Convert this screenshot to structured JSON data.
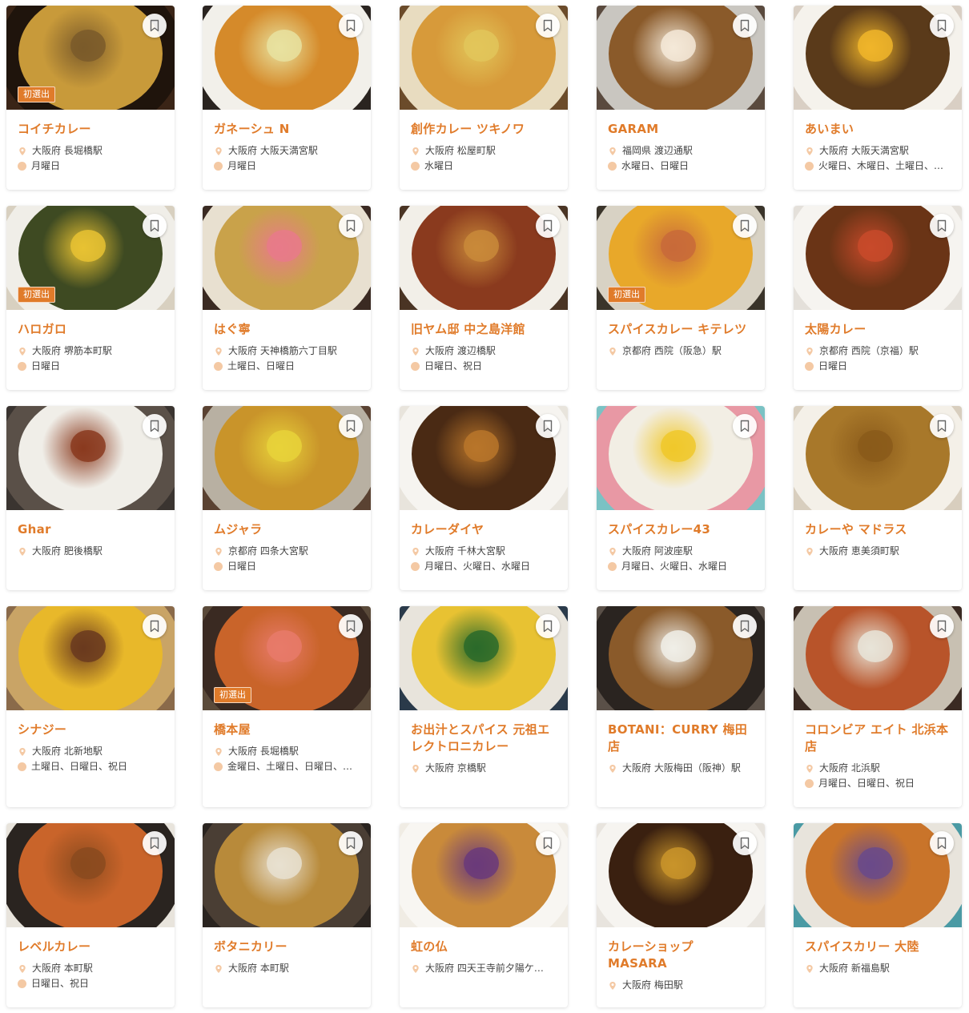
{
  "badge_label": "初選出",
  "accent_color": "#e07b2a",
  "icons": {
    "bookmark": "bookmark-icon",
    "location": "location-pin-icon",
    "holiday": "holiday-icon"
  },
  "rows": [
    [
      {
        "name": "コイチカレー",
        "location": "大阪府 長堀橋駅",
        "holiday": "月曜日",
        "badge": true,
        "photo": {
          "bg": "#3a2416",
          "plate": "#1f140c",
          "food": "#c89a3a",
          "accent": "#7a5a2a"
        }
      },
      {
        "name": "ガネーシュ N",
        "location": "大阪府 大阪天満宮駅",
        "holiday": "月曜日",
        "badge": false,
        "photo": {
          "bg": "#2a2420",
          "plate": "#f2f0ea",
          "food": "#d58a2a",
          "accent": "#e8e2a0"
        }
      },
      {
        "name": "創作カレー ツキノワ",
        "location": "大阪府 松屋町駅",
        "holiday": "水曜日",
        "badge": false,
        "photo": {
          "bg": "#6b4b2a",
          "plate": "#e8dcc0",
          "food": "#d79a3a",
          "accent": "#e2c65a"
        }
      },
      {
        "name": "GARAM",
        "location": "福岡県 渡辺通駅",
        "holiday": "水曜日、日曜日",
        "badge": false,
        "photo": {
          "bg": "#5a4a3e",
          "plate": "#c9c6c0",
          "food": "#8a5a2a",
          "accent": "#f4e9d8"
        }
      },
      {
        "name": "あいまい",
        "location": "大阪府 大阪天満宮駅",
        "holiday": "火曜日、木曜日、土曜日、…",
        "badge": false,
        "photo": {
          "bg": "#d9cfc4",
          "plate": "#f5f2ec",
          "food": "#5a3a1a",
          "accent": "#f0b52a"
        }
      }
    ],
    [
      {
        "name": "ハロガロ",
        "location": "大阪府 堺筋本町駅",
        "holiday": "日曜日",
        "badge": true,
        "photo": {
          "bg": "#d8d0c0",
          "plate": "#f0eee8",
          "food": "#3e4a22",
          "accent": "#e8c232"
        }
      },
      {
        "name": "はぐ寧",
        "location": "大阪府 天神橋筋六丁目駅",
        "holiday": "土曜日、日曜日",
        "badge": false,
        "photo": {
          "bg": "#3a2a22",
          "plate": "#e8e0d0",
          "food": "#c9a24a",
          "accent": "#e87a8a"
        }
      },
      {
        "name": "旧ヤム邸 中之島洋館",
        "location": "大阪府 渡辺橋駅",
        "holiday": "日曜日、祝日",
        "badge": false,
        "photo": {
          "bg": "#4a3424",
          "plate": "#f2efe8",
          "food": "#8a3a1e",
          "accent": "#c98a3a"
        }
      },
      {
        "name": "スパイスカレー キテレツ",
        "location": "京都府 西院（阪急）駅",
        "holiday": "",
        "badge": true,
        "photo": {
          "bg": "#3a342a",
          "plate": "#d8d2c4",
          "food": "#e8a82a",
          "accent": "#c86a3a"
        }
      },
      {
        "name": "太陽カレー",
        "location": "京都府 西院（京福）駅",
        "holiday": "日曜日",
        "badge": false,
        "photo": {
          "bg": "#e4e0da",
          "plate": "#f6f4f0",
          "food": "#6a3416",
          "accent": "#c84a2a"
        }
      }
    ],
    [
      {
        "name": "Ghar",
        "location": "大阪府 肥後橋駅",
        "holiday": "",
        "badge": false,
        "photo": {
          "bg": "#3a3430",
          "plate": "#5a5048",
          "food": "#f0eee8",
          "accent": "#8a3a1e"
        }
      },
      {
        "name": "ムジャラ",
        "location": "京都府 四条大宮駅",
        "holiday": "日曜日",
        "badge": false,
        "photo": {
          "bg": "#5a4232",
          "plate": "#b8b0a2",
          "food": "#c9942a",
          "accent": "#e8d23a"
        }
      },
      {
        "name": "カレーダイヤ",
        "location": "大阪府 千林大宮駅",
        "holiday": "月曜日、火曜日、水曜日",
        "badge": false,
        "photo": {
          "bg": "#e8e4dc",
          "plate": "#f6f4f0",
          "food": "#4a2a14",
          "accent": "#b8752a"
        }
      },
      {
        "name": "スパイスカレー43",
        "location": "大阪府 阿波座駅",
        "holiday": "月曜日、火曜日、水曜日",
        "badge": false,
        "photo": {
          "bg": "#7ac2c4",
          "plate": "#e898a4",
          "food": "#f2eee4",
          "accent": "#f0c82a"
        }
      },
      {
        "name": "カレーや マドラス",
        "location": "大阪府 恵美須町駅",
        "holiday": "",
        "badge": false,
        "photo": {
          "bg": "#d8cebe",
          "plate": "#f4f0e8",
          "food": "#a8782a",
          "accent": "#8a5a1a"
        }
      }
    ],
    [
      {
        "name": "シナジー",
        "location": "大阪府 北新地駅",
        "holiday": "土曜日、日曜日、祝日",
        "badge": false,
        "photo": {
          "bg": "#8a6a4a",
          "plate": "#c9a466",
          "food": "#e8b82a",
          "accent": "#6a3a1e"
        }
      },
      {
        "name": "橋本屋",
        "location": "大阪府 長堀橋駅",
        "holiday": "金曜日、土曜日、日曜日、…",
        "badge": true,
        "photo": {
          "bg": "#5a4a3a",
          "plate": "#3a2a22",
          "food": "#c9642a",
          "accent": "#e87a6a"
        }
      },
      {
        "name": "お出汁とスパイス 元祖エレクトロニカレー",
        "location": "大阪府 京橋駅",
        "holiday": "",
        "badge": false,
        "photo": {
          "bg": "#2a3a4a",
          "plate": "#e8e4dc",
          "food": "#e8c232",
          "accent": "#2a6a2a"
        }
      },
      {
        "name": "BOTANI：CURRY 梅田店",
        "location": "大阪府 大阪梅田（阪神）駅",
        "holiday": "",
        "badge": false,
        "photo": {
          "bg": "#5a5048",
          "plate": "#2a2420",
          "food": "#8a5a2a",
          "accent": "#f0eee8"
        }
      },
      {
        "name": "コロンビア エイト 北浜本店",
        "location": "大阪府 北浜駅",
        "holiday": "月曜日、日曜日、祝日",
        "badge": false,
        "photo": {
          "bg": "#3a2a22",
          "plate": "#c8c0b2",
          "food": "#b8542a",
          "accent": "#e8e4d8"
        }
      }
    ],
    [
      {
        "name": "レベルカレー",
        "location": "大阪府 本町駅",
        "holiday": "日曜日、祝日",
        "badge": false,
        "photo": {
          "bg": "#e8e4dc",
          "plate": "#2a2420",
          "food": "#c9642a",
          "accent": "#8a4a1e"
        }
      },
      {
        "name": "ボタニカリー",
        "location": "大阪府 本町駅",
        "holiday": "",
        "badge": false,
        "photo": {
          "bg": "#2a2420",
          "plate": "#4a3e34",
          "food": "#b88a3a",
          "accent": "#e8e0d0"
        }
      },
      {
        "name": "虹の仏",
        "location": "大阪府 四天王寺前夕陽ケ…",
        "holiday": "",
        "badge": false,
        "photo": {
          "bg": "#f0ece4",
          "plate": "#f8f6f2",
          "food": "#c98a3a",
          "accent": "#6a3a7a"
        }
      },
      {
        "name": "カレーショップ MASARA",
        "location": "大阪府 梅田駅",
        "holiday": "",
        "badge": false,
        "photo": {
          "bg": "#e8e4de",
          "plate": "#f6f4f0",
          "food": "#3a2010",
          "accent": "#c9942a"
        }
      },
      {
        "name": "スパイスカリー 大陸",
        "location": "大阪府 新福島駅",
        "holiday": "",
        "badge": false,
        "photo": {
          "bg": "#4a9aa4",
          "plate": "#e8e4dc",
          "food": "#c9742a",
          "accent": "#6a4a8a"
        }
      }
    ]
  ]
}
